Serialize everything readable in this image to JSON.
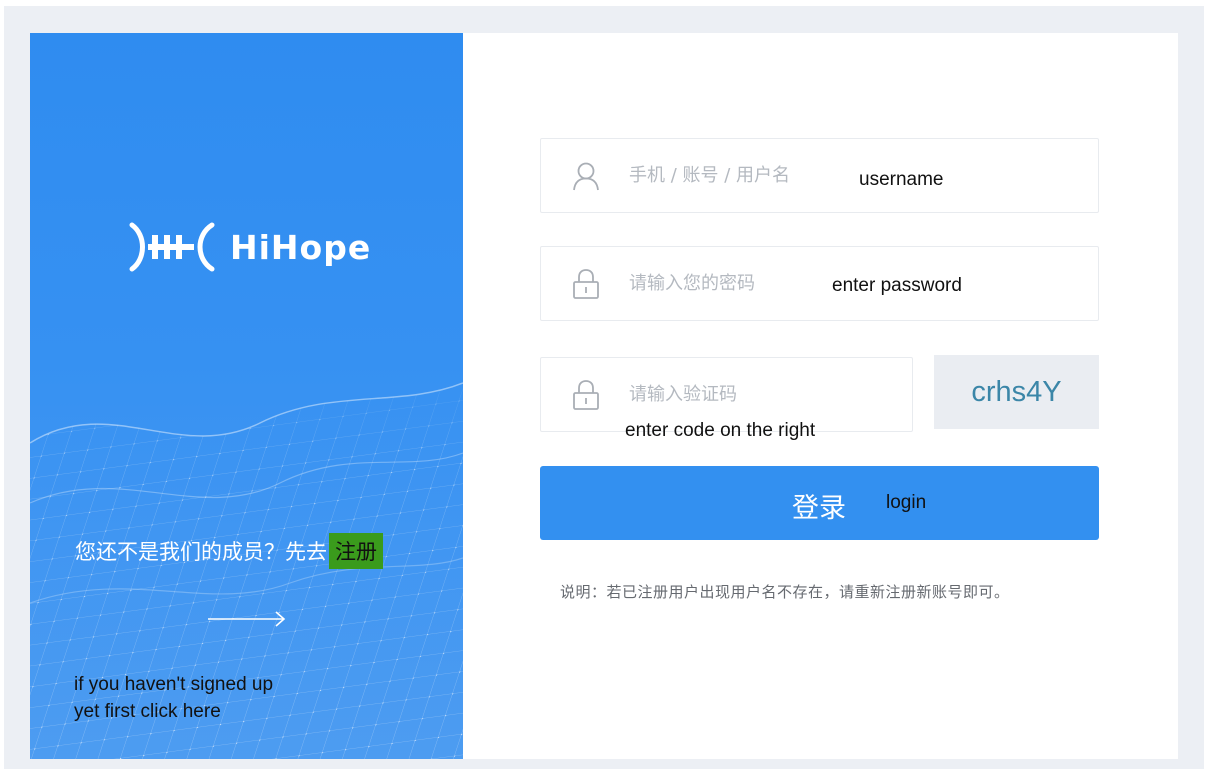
{
  "brand": {
    "name": "HiHope",
    "mark": ")⊞("
  },
  "left_panel": {
    "member_prompt": "您还不是我们的成员？先去",
    "register_label": "注册",
    "annotation_line1": "if you haven't signed up",
    "annotation_line2": "yet first click here"
  },
  "form": {
    "username": {
      "placeholder": "手机 / 账号 / 用户名",
      "value": "",
      "annotation": "username"
    },
    "password": {
      "placeholder": "请输入您的密码",
      "value": "",
      "annotation": "enter password"
    },
    "captcha": {
      "placeholder": "请输入验证码",
      "value": "",
      "annotation": "enter code on the right",
      "code": "crhs4Y"
    },
    "login": {
      "label": "登录",
      "annotation": "login"
    },
    "explanation": "说明：若已注册用户出现用户名不存在，请重新注册新账号即可。"
  },
  "colors": {
    "panel_blue": "#2f8cf0",
    "button_blue": "#3390f0",
    "register_highlight": "#3a9b1c",
    "captcha_text": "#3b86a8"
  },
  "icons": [
    "user-icon",
    "lock-icon",
    "arrow-right-icon",
    "hihope-logo-mark"
  ]
}
